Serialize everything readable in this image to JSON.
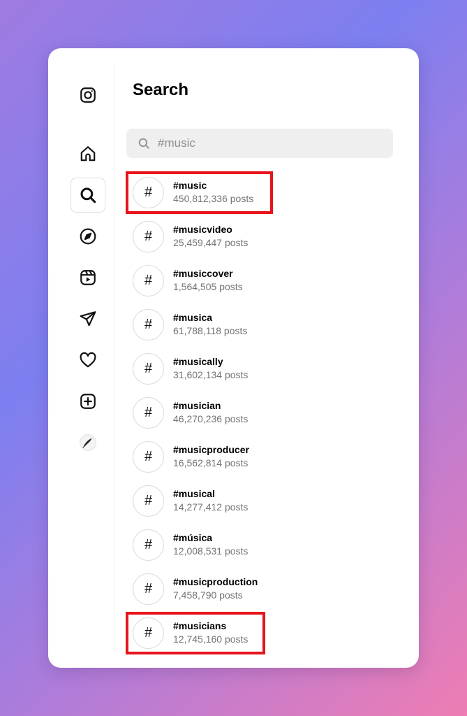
{
  "page": {
    "title": "Search"
  },
  "search": {
    "value": "#music",
    "placeholder": "Search"
  },
  "sidebar": {
    "items": [
      {
        "name": "instagram-logo-icon"
      },
      {
        "name": "home-icon"
      },
      {
        "name": "search-icon",
        "active": true
      },
      {
        "name": "explore-compass-icon"
      },
      {
        "name": "reels-icon"
      },
      {
        "name": "messages-send-icon"
      },
      {
        "name": "notifications-heart-icon"
      },
      {
        "name": "create-plus-icon"
      },
      {
        "name": "profile-avatar"
      }
    ]
  },
  "results": [
    {
      "symbol": "#",
      "tag": "#music",
      "count": "450,812,336 posts",
      "highlighted": true
    },
    {
      "symbol": "#",
      "tag": "#musicvideo",
      "count": "25,459,447 posts"
    },
    {
      "symbol": "#",
      "tag": "#musiccover",
      "count": "1,564,505 posts"
    },
    {
      "symbol": "#",
      "tag": "#musica",
      "count": "61,788,118 posts"
    },
    {
      "symbol": "#",
      "tag": "#musically",
      "count": "31,602,134 posts"
    },
    {
      "symbol": "#",
      "tag": "#musician",
      "count": "46,270,236 posts"
    },
    {
      "symbol": "#",
      "tag": "#musicproducer",
      "count": "16,562,814 posts"
    },
    {
      "symbol": "#",
      "tag": "#musical",
      "count": "14,277,412 posts"
    },
    {
      "symbol": "#",
      "tag": "#música",
      "count": "12,008,531 posts"
    },
    {
      "symbol": "#",
      "tag": "#musicproduction",
      "count": "7,458,790 posts"
    },
    {
      "symbol": "#",
      "tag": "#musicians",
      "count": "12,745,160 posts",
      "highlighted": true
    }
  ],
  "colors": {
    "highlight": "#e8141c",
    "secondary_text": "#737373",
    "search_bg": "#efefef"
  }
}
